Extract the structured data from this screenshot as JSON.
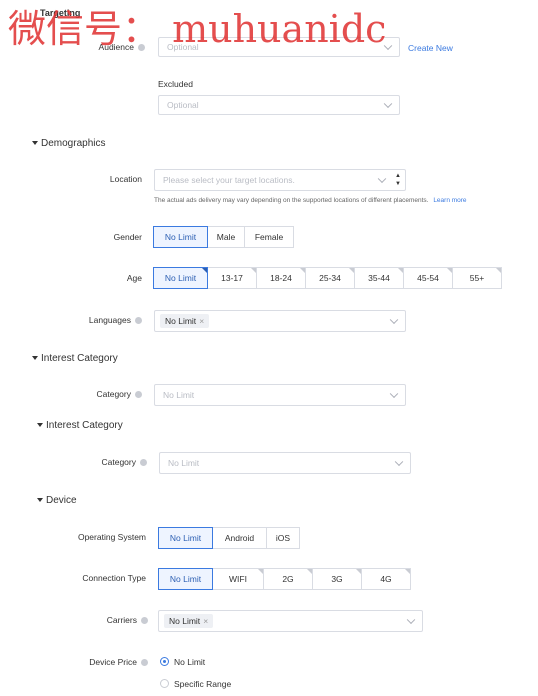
{
  "watermark": "微信号： muhuanidc",
  "targeting": {
    "title": "Targeting",
    "audience_label": "Audience",
    "audience_placeholder": "Optional",
    "create_new": "Create New",
    "excluded_label": "Excluded",
    "excluded_placeholder": "Optional"
  },
  "demographics": {
    "title": "Demographics",
    "location_label": "Location",
    "location_placeholder": "Please select your target locations.",
    "location_note": "The actual ads delivery may vary depending on the supported locations of different placements.",
    "learn_more": "Learn more",
    "gender_label": "Gender",
    "gender_options": [
      "No Limit",
      "Male",
      "Female"
    ],
    "age_label": "Age",
    "age_options": [
      "No Limit",
      "13-17",
      "18-24",
      "25-34",
      "35-44",
      "45-54",
      "55+"
    ],
    "languages_label": "Languages",
    "languages_tag": "No Limit"
  },
  "interest1": {
    "title": "Interest Category",
    "category_label": "Category",
    "placeholder": "No Limit"
  },
  "interest2": {
    "title": "Interest Category",
    "category_label": "Category",
    "placeholder": "No Limit"
  },
  "device": {
    "title": "Device",
    "os_label": "Operating System",
    "os_options": [
      "No Limit",
      "Android",
      "iOS"
    ],
    "connection_label": "Connection Type",
    "connection_options": [
      "No Limit",
      "WIFI",
      "2G",
      "3G",
      "4G"
    ],
    "carriers_label": "Carriers",
    "carriers_tag": "No Limit",
    "price_label": "Device Price",
    "price_options": [
      "No Limit",
      "Specific Range"
    ]
  },
  "colors": {
    "accent": "#3b7ae0",
    "watermark": "#e03030"
  }
}
